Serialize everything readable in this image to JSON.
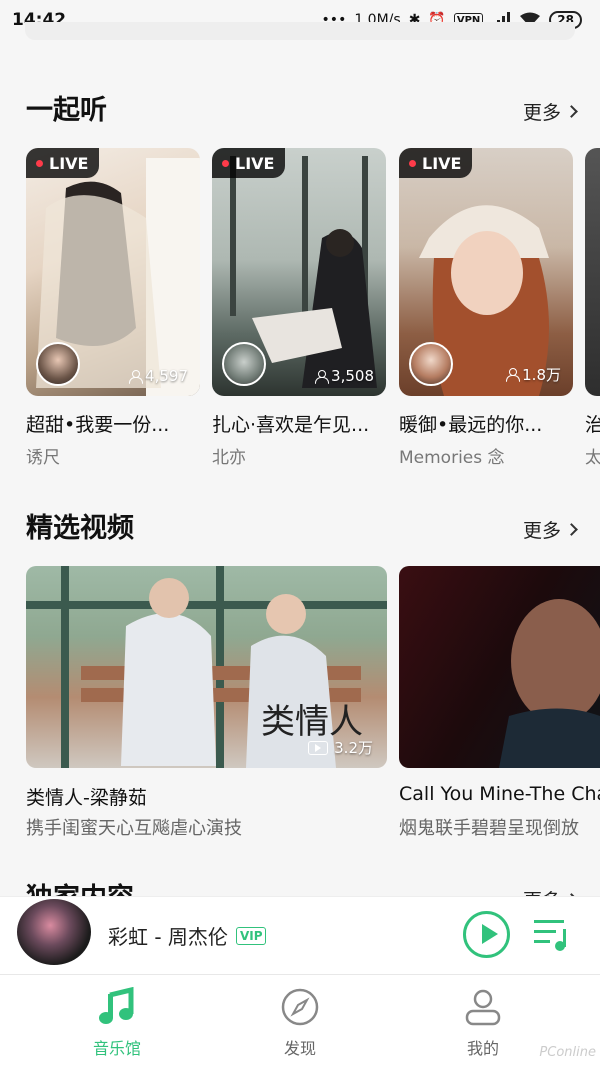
{
  "status_bar": {
    "time": "14:42",
    "speed": "1.0M/s",
    "vpn": "VPN",
    "battery": "28"
  },
  "listen_together": {
    "title": "一起听",
    "more": "更多",
    "cards": [
      {
        "badge": "LIVE",
        "listeners": "4,597",
        "title": "超甜•我要一份...",
        "host": "诱尺"
      },
      {
        "badge": "LIVE",
        "listeners": "3,508",
        "title": "扎心·喜欢是乍见...",
        "host": "北亦"
      },
      {
        "badge": "LIVE",
        "listeners": "1.8万",
        "title": "暖御•最远的你...",
        "host": "Memories 念"
      },
      {
        "title": "治",
        "host": "太"
      }
    ]
  },
  "featured_videos": {
    "title": "精选视频",
    "more": "更多",
    "cards": [
      {
        "views": "3.2万",
        "overlay_text": "类情人",
        "title": "类情人-梁静茹",
        "subtitle": "携手闺蜜天心互飚虐心演技"
      },
      {
        "title": "Call You Mine-The Cha",
        "subtitle": "烟鬼联手碧碧呈现倒放"
      }
    ]
  },
  "exclusive": {
    "title": "独家内容",
    "more": "更多"
  },
  "player": {
    "song": "彩虹 - 周杰伦",
    "vip": "VIP"
  },
  "nav": {
    "items": [
      {
        "label": "音乐馆",
        "icon": "music-note-icon",
        "active": true
      },
      {
        "label": "发现",
        "icon": "compass-icon"
      },
      {
        "label": "我的",
        "icon": "person-icon"
      }
    ]
  },
  "watermark": "PConline",
  "colors": {
    "accent": "#31c27c",
    "live_dot": "#ff3b4a"
  }
}
